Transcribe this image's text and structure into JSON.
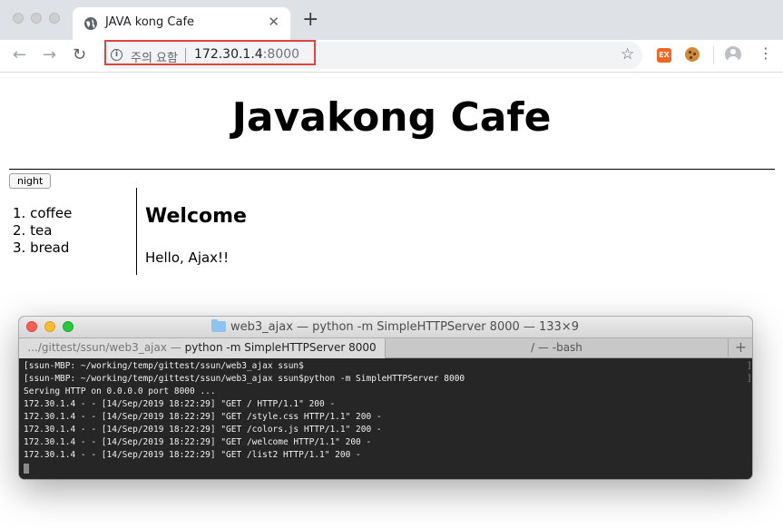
{
  "browser": {
    "tab_title": "JAVA kong Cafe",
    "tab_close": "✕",
    "new_tab": "+",
    "nav": {
      "back": "←",
      "forward": "→",
      "reload": "↻"
    },
    "omnibox": {
      "info": "i",
      "security_warning": "주의 요함",
      "url_host": "172.30.1.4",
      "url_port": ":8000"
    },
    "bookmark_star": "☆",
    "extension_label": "EX",
    "menu": "⋮"
  },
  "page": {
    "title": "Javakong Cafe",
    "night_button": "night",
    "nav_items": [
      "coffee",
      "tea",
      "bread"
    ],
    "heading": "Welcome",
    "body_text": "Hello, Ajax!!"
  },
  "terminal": {
    "window_title": "web3_ajax — python -m SimpleHTTPServer 8000 — 133×9",
    "tab1_path": ".../gittest/ssun/web3_ajax — ",
    "tab1_command": "python -m SimpleHTTPServer 8000",
    "tab2": "/ — -bash",
    "tab_add": "+",
    "lines": [
      "[ssun-MBP: ~/working/temp/gittest/ssun/web3_ajax ssun$",
      "[ssun-MBP: ~/working/temp/gittest/ssun/web3_ajax ssun$python -m SimpleHTTPServer 8000",
      "Serving HTTP on 0.0.0.0 port 8000 ...",
      "172.30.1.4 - - [14/Sep/2019 18:22:29] \"GET / HTTP/1.1\" 200 -",
      "172.30.1.4 - - [14/Sep/2019 18:22:29] \"GET /style.css HTTP/1.1\" 200 -",
      "172.30.1.4 - - [14/Sep/2019 18:22:29] \"GET /colors.js HTTP/1.1\" 200 -",
      "172.30.1.4 - - [14/Sep/2019 18:22:29] \"GET /welcome HTTP/1.1\" 200 -",
      "172.30.1.4 - - [14/Sep/2019 18:22:29] \"GET /list2 HTTP/1.1\" 200 -"
    ],
    "right_bracket": "]"
  },
  "colors": {
    "highlight_box": "#e0443e",
    "terminal_bg": "#262626",
    "tab_bar": "#dee1e6"
  }
}
